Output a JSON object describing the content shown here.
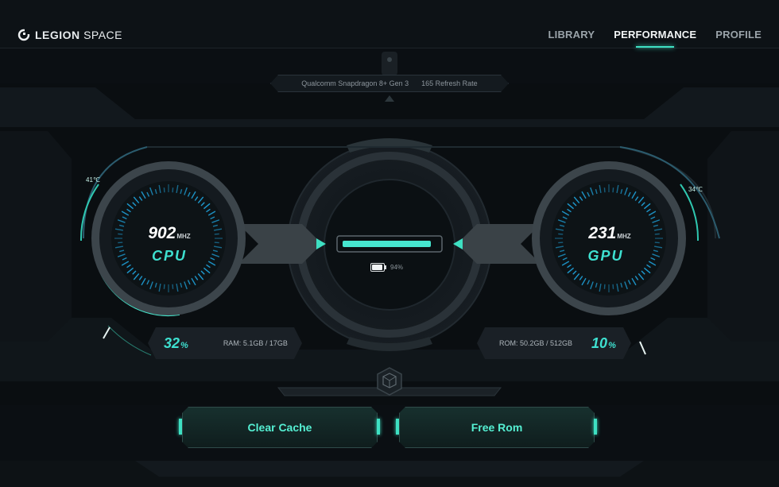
{
  "app": {
    "logo_bold": "LEGION",
    "logo_light": "SPACE"
  },
  "nav": {
    "tabs": [
      {
        "label": "LIBRARY",
        "active": false
      },
      {
        "label": "PERFORMANCE",
        "active": true
      },
      {
        "label": "PROFILE",
        "active": false
      }
    ]
  },
  "device": {
    "chip": "Qualcomm Snapdragon 8+ Gen 3",
    "refresh": "165 Refresh Rate"
  },
  "cpu": {
    "value": "902",
    "unit": "MHZ",
    "label": "CPU",
    "temp": "41℃",
    "load_percent": 32,
    "load_unit": "%",
    "ram_text": "RAM: 5.1GB / 17GB"
  },
  "gpu": {
    "value": "231",
    "unit": "MHZ",
    "label": "GPU",
    "temp": "34℃",
    "load_percent": 10,
    "load_unit": "%",
    "rom_text": "ROM: 50.2GB / 512GB"
  },
  "battery": {
    "level_text": "94%",
    "level": 94
  },
  "actions": {
    "clear_cache": "Clear Cache",
    "free_rom": "Free Rom"
  },
  "colors": {
    "accent": "#3ee0c2",
    "background": "#0b0f13"
  },
  "icons": {
    "logo": "legion-logo-icon",
    "battery": "battery-icon",
    "cube": "cube-emblem-icon"
  }
}
